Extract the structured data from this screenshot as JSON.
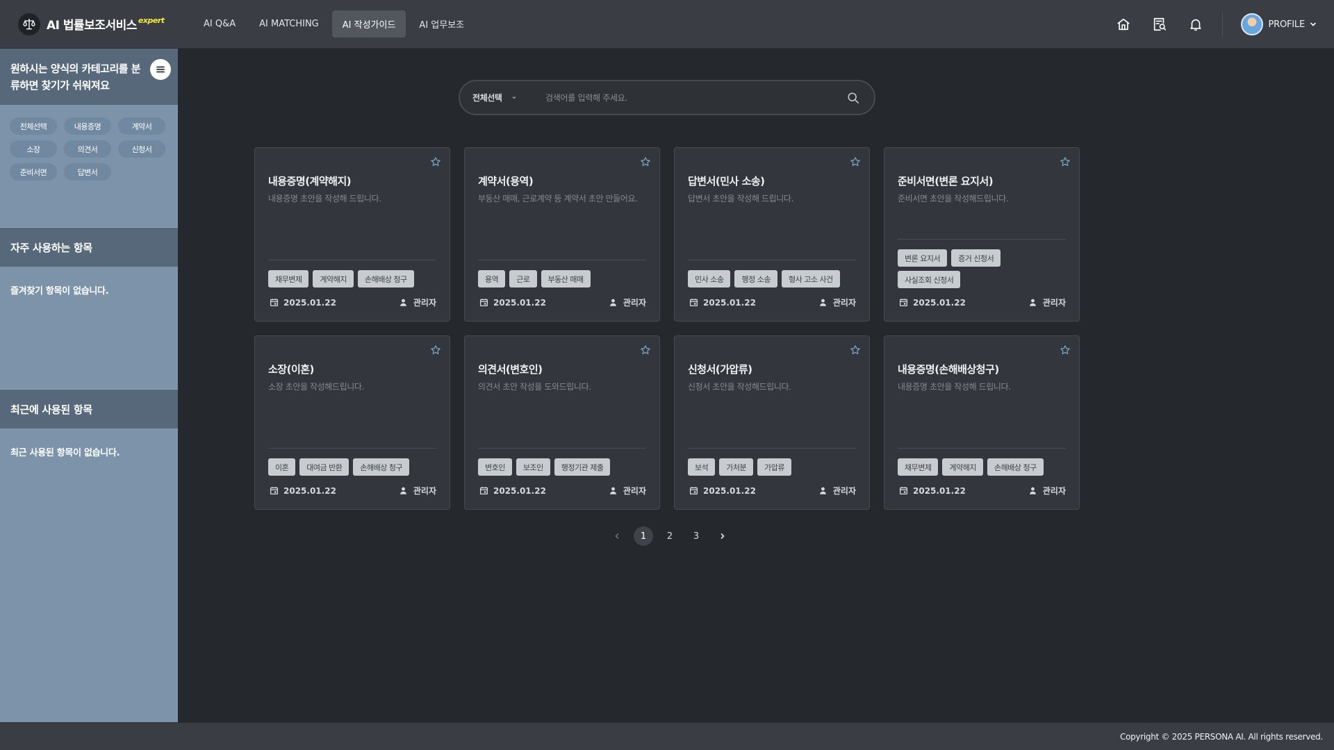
{
  "colors": {
    "header_bg": "#3a3e44",
    "main_bg": "#25282d",
    "sidebar_bg": "#7c93a9",
    "sidebar_head": "#57687a",
    "card_bg": "#33373d",
    "tag_bg": "#c7ccd1",
    "brand_accent": "#f6e93b"
  },
  "header": {
    "brand": {
      "icon": "scales-icon",
      "name": "AI 법률보조서비스",
      "badge": "expert"
    },
    "nav": [
      {
        "label": "AI Q&A",
        "active": false
      },
      {
        "label": "AI MATCHING",
        "active": false
      },
      {
        "label": "AI 작성가이드",
        "active": true
      },
      {
        "label": "AI 업무보조",
        "active": false
      }
    ],
    "icons": [
      "home-icon",
      "document-search-icon",
      "bell-icon"
    ],
    "profile_label": "PROFILE"
  },
  "sidebar": {
    "category_title": "원하시는 양식의 카테고리를 분류하면 찾기가 쉬워져요",
    "categories": [
      "전체선택",
      "내용증명",
      "계약서",
      "소장",
      "의견서",
      "신청서",
      "준비서면",
      "답변서"
    ],
    "favorites": {
      "title": "자주 사용하는 항목",
      "empty": "즐겨찾기 항목이 없습니다."
    },
    "recent": {
      "title": "최근에 사용된 항목",
      "empty": "최근 사용된 항목이 없습니다."
    }
  },
  "search": {
    "select_label": "전체선택",
    "placeholder": "검색어를 입력해 주세요."
  },
  "cards": [
    {
      "title": "내용증명(계약해지)",
      "desc": "내용증명 초안을 작성해 드립니다.",
      "tags": [
        "채무변제",
        "계약해지",
        "손해배상 청구"
      ],
      "date": "2025.01.22",
      "author": "관리자"
    },
    {
      "title": "계약서(용역)",
      "desc": "부동산 매매, 근로계약 등 계약서 초안 만들어요.",
      "tags": [
        "용역",
        "근로",
        "부동산 매매"
      ],
      "date": "2025.01.22",
      "author": "관리자"
    },
    {
      "title": "답변서(민사 소송)",
      "desc": "답변서 초안을 작성해 드립니다.",
      "tags": [
        "민사 소송",
        "행정 소송",
        "형사 고소 사건"
      ],
      "date": "2025.01.22",
      "author": "관리자"
    },
    {
      "title": "준비서면(변론 요지서)",
      "desc": "준비서면 초안을 작성해드립니다.",
      "tags": [
        "변론 요지서",
        "증거 신청서",
        "사실조회 신청서"
      ],
      "date": "2025.01.22",
      "author": "관리자"
    },
    {
      "title": "소장(이혼)",
      "desc": "소장 초안을 작성해드립니다.",
      "tags": [
        "이혼",
        "대여금 반환",
        "손해배상 청구"
      ],
      "date": "2025.01.22",
      "author": "관리자"
    },
    {
      "title": "의견서(변호인)",
      "desc": "의견서 초안 작성을 도와드립니다.",
      "tags": [
        "변호인",
        "보조인",
        "행정기관 제출"
      ],
      "date": "2025.01.22",
      "author": "관리자"
    },
    {
      "title": "신청서(가압류)",
      "desc": "신청서 초안을 작성해드립니다.",
      "tags": [
        "보석",
        "가처분",
        "가압류"
      ],
      "date": "2025.01.22",
      "author": "관리자"
    },
    {
      "title": "내용증명(손해배상청구)",
      "desc": "내용증명 초안을 작성해 드립니다.",
      "tags": [
        "채무변제",
        "계약해지",
        "손해배상 청구"
      ],
      "date": "2025.01.22",
      "author": "관리자"
    }
  ],
  "pagination": {
    "pages": [
      "1",
      "2",
      "3"
    ],
    "current": "1"
  },
  "footer": {
    "copyright": "Copyright © 2025 PERSONA AI. All rights reserved."
  }
}
